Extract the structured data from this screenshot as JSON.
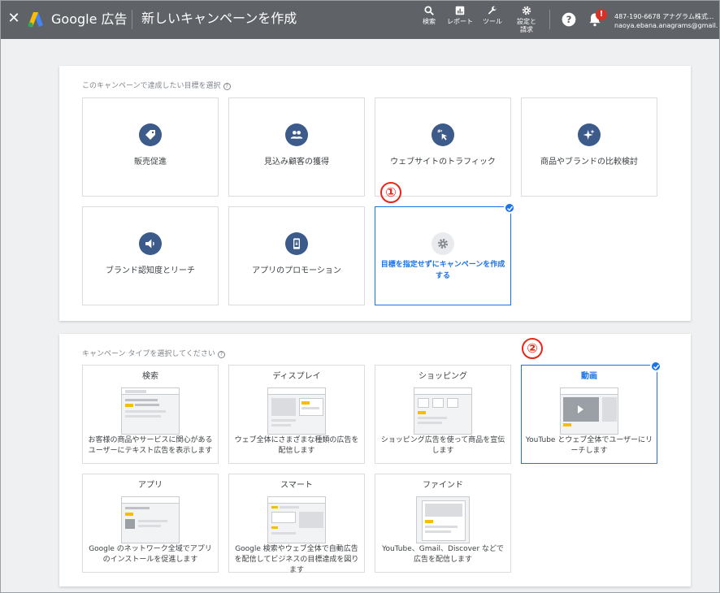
{
  "header": {
    "close_icon": "close-icon",
    "brand": "Google 広告",
    "title": "新しいキャンペーンを作成",
    "tools": [
      {
        "label": "検索",
        "icon": "search-icon"
      },
      {
        "label": "レポート",
        "icon": "report-icon"
      },
      {
        "label": "ツール",
        "icon": "wrench-icon"
      },
      {
        "label": "設定と請求",
        "icon": "gear-icon"
      }
    ],
    "help_icon": "help-icon",
    "notifications_icon": "bell-icon",
    "notification_badge": "!",
    "account_id": "487-190-6678 アナグラム株式...",
    "account_email": "naoya.ebana.anagrams@gmail...."
  },
  "goals": {
    "title": "このキャンペーンで達成したい目標を選択",
    "items": [
      {
        "label": "販売促進",
        "icon": "tag-icon"
      },
      {
        "label": "見込み顧客の獲得",
        "icon": "people-icon"
      },
      {
        "label": "ウェブサイトのトラフィック",
        "icon": "cursor-click-icon"
      },
      {
        "label": "商品やブランドの比較検討",
        "icon": "sparkle-icon"
      },
      {
        "label": "ブランド認知度とリーチ",
        "icon": "speaker-icon"
      },
      {
        "label": "アプリのプロモーション",
        "icon": "smartphone-icon"
      },
      {
        "label": "目標を指定せずにキャンペーンを作成する",
        "icon": "gear-icon",
        "selected": true
      }
    ]
  },
  "types": {
    "title": "キャンペーン タイプを選択してください",
    "items": [
      {
        "label": "検索",
        "description": "お客様の商品やサービスに関心があるユーザーにテキスト広告を表示します"
      },
      {
        "label": "ディスプレイ",
        "description": "ウェブ全体にさまざまな種類の広告を配信します"
      },
      {
        "label": "ショッピング",
        "description": "ショッピング広告を使って商品を宣伝します"
      },
      {
        "label": "動画",
        "description": "YouTube とウェブ全体でユーザーにリーチします",
        "selected": true
      },
      {
        "label": "アプリ",
        "description": "Google のネットワーク全域でアプリのインストールを促進します"
      },
      {
        "label": "スマート",
        "description": "Google 検索やウェブ全体で自動広告を配信してビジネスの目標達成を図ります"
      },
      {
        "label": "ファインド",
        "description": "YouTube、Gmail、Discover などで広告を配信します"
      }
    ]
  },
  "annotations": [
    "①",
    "②"
  ],
  "colors": {
    "topbar": "#5f6368",
    "accent": "#1a73e8",
    "icon_circle": "#3c5a8a",
    "annotation": "#e5281b",
    "ad_yellow": "#fbbc04"
  }
}
